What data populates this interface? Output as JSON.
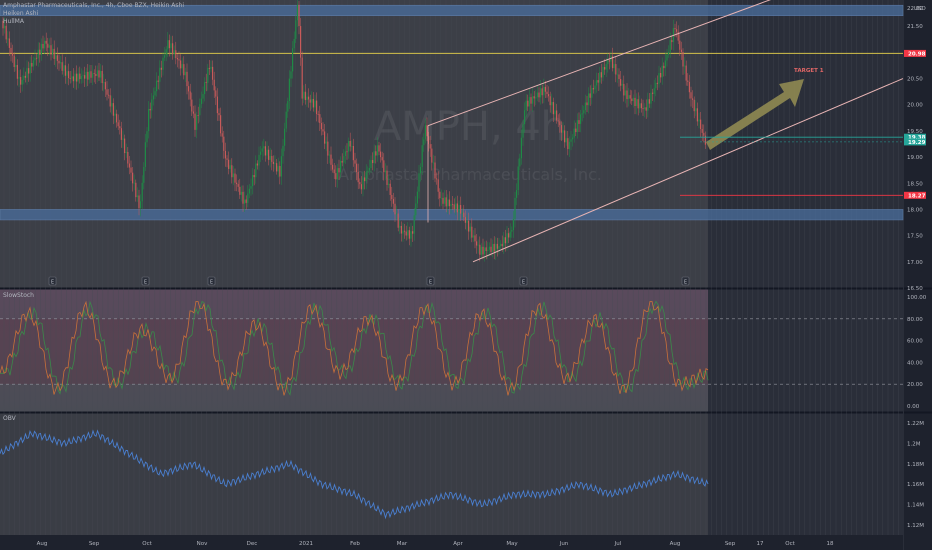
{
  "header": {
    "title": "Amphastar Pharmaceuticals, Inc., 4h, Cboe BZX, Heikin Ashi",
    "line2": "Heiken Ashi",
    "line3": "HullMA"
  },
  "watermark": {
    "symbol": "AMPH, 4h",
    "name": "Amphastar Pharmaceuticals, Inc."
  },
  "price_panel": {
    "currency": "USD",
    "ylim": [
      16.5,
      22.0
    ],
    "yticks": [
      "22.00",
      "21.50",
      "21.00",
      "20.50",
      "20.00",
      "19.50",
      "19.00",
      "18.50",
      "18.00",
      "17.50",
      "17.00",
      "16.50"
    ],
    "price_labels": [
      {
        "text": "20.98",
        "value": 20.98,
        "color": "#f23645"
      },
      {
        "text": "19.38",
        "value": 19.38,
        "color": "#26a69a"
      },
      {
        "text": "19.29",
        "value": 19.29,
        "color": "#26a69a"
      },
      {
        "text": "18.27",
        "value": 18.27,
        "color": "#f23645"
      }
    ],
    "annotation": "TARGET 1",
    "earnings_marker": "E"
  },
  "stoch_panel": {
    "label": "SlowStoch",
    "ylim": [
      0,
      100
    ],
    "yticks": [
      "100.00",
      "80.00",
      "60.00",
      "40.00",
      "20.00",
      "0.00"
    ],
    "upper_band": 80,
    "lower_band": 20
  },
  "obv_panel": {
    "label": "OBV",
    "yticks": [
      "1.22M",
      "1.2M",
      "1.18M",
      "1.16M",
      "1.14M",
      "1.12M"
    ]
  },
  "time_axis": {
    "labels": [
      "Aug",
      "Sep",
      "Oct",
      "Nov",
      "Dec",
      "2021",
      "Feb",
      "Mar",
      "Apr",
      "May",
      "Jun",
      "Jul",
      "Aug",
      "Sep",
      "17",
      "Oct",
      "18"
    ]
  },
  "chart_data": [
    {
      "type": "candlestick",
      "title": "Amphastar Pharmaceuticals, Inc., 4h, Cboe BZX, Heikin Ashi",
      "x": [
        "Aug",
        "Sep",
        "Oct",
        "Nov",
        "Dec",
        "2021",
        "Feb",
        "Mar",
        "Apr",
        "May",
        "Jun",
        "Jul",
        "Aug"
      ],
      "close_approx": [
        21.1,
        20.3,
        21.2,
        20.8,
        18.4,
        20.5,
        19.1,
        19.0,
        17.4,
        18.2,
        20.4,
        20.9,
        19.3
      ],
      "support_zones": [
        [
          21.7,
          21.9
        ],
        [
          17.8,
          18.0
        ]
      ],
      "horizontal_line": 20.98,
      "channel_upper": [
        [
          19.6,
          19.75
        ],
        [
          21.6,
          22.2
        ]
      ],
      "channel_lower": [
        [
          17.0,
          16.9
        ],
        [
          18.9,
          20.5
        ]
      ],
      "ylim": [
        16.5,
        22.0
      ]
    },
    {
      "type": "line",
      "title": "SlowStoch",
      "series": [
        {
          "name": "",
          "values": [
            30,
            85,
            15,
            90,
            20,
            70,
            25,
            95,
            20,
            75,
            15,
            90,
            30,
            80,
            20,
            90,
            20,
            85,
            15,
            90,
            25,
            80,
            15,
            95,
            20,
            30
          ]
        }
      ],
      "ylim": [
        0,
        100
      ]
    },
    {
      "type": "line",
      "title": "OBV",
      "series": [
        {
          "name": "",
          "values": [
            1.19,
            1.21,
            1.2,
            1.21,
            1.19,
            1.17,
            1.18,
            1.16,
            1.17,
            1.18,
            1.16,
            1.15,
            1.13,
            1.14,
            1.15,
            1.14,
            1.15,
            1.15,
            1.16,
            1.15,
            1.16,
            1.17,
            1.16
          ]
        }
      ]
    }
  ]
}
